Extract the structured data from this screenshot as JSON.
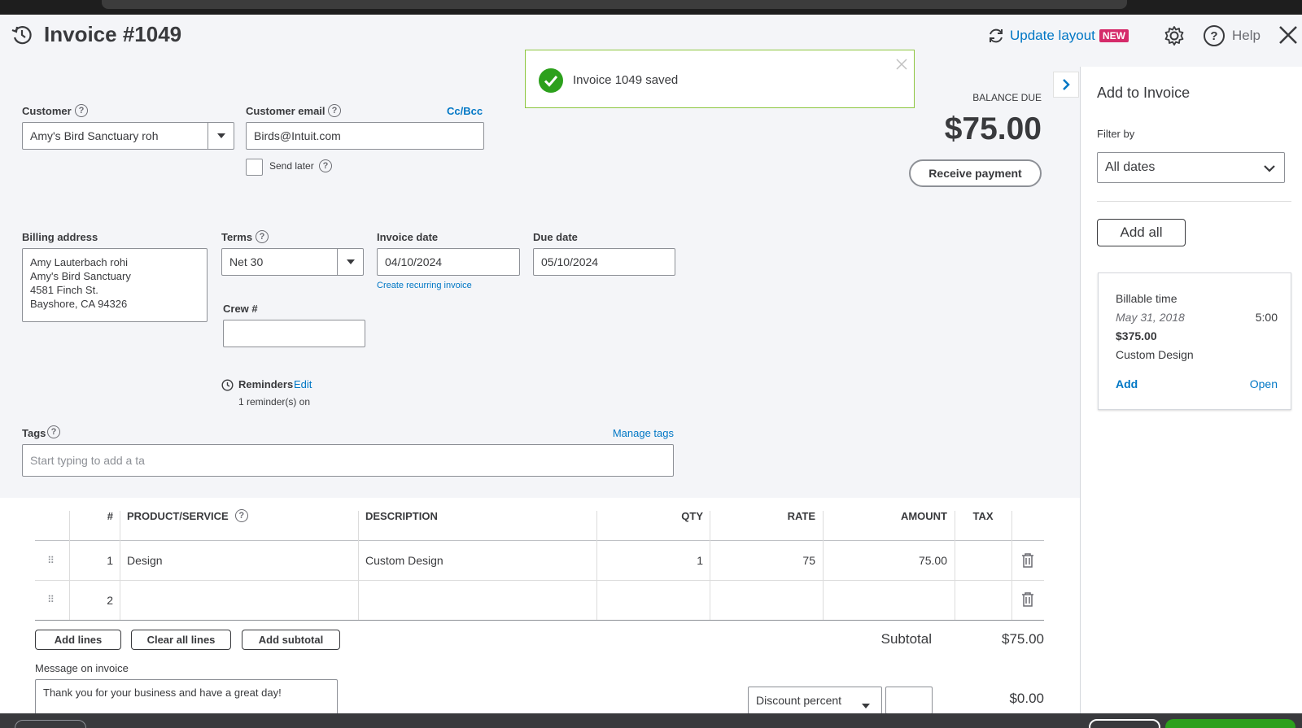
{
  "header": {
    "title": "Invoice #1049",
    "update_layout": "Update layout",
    "new_badge": "NEW",
    "help": "Help"
  },
  "toast": {
    "message": "Invoice 1049 saved"
  },
  "customer": {
    "label": "Customer",
    "value": "Amy's Bird Sanctuary roh"
  },
  "email": {
    "label": "Customer email",
    "cc_bcc": "Cc/Bcc",
    "value": "Birds@Intuit.com",
    "send_later": "Send later"
  },
  "balance": {
    "label": "BALANCE DUE",
    "amount": "$75.00",
    "receive_button": "Receive payment"
  },
  "billing": {
    "label": "Billing address",
    "lines": [
      "Amy Lauterbach rohi",
      "Amy's Bird Sanctuary",
      "4581 Finch St.",
      "Bayshore, CA  94326"
    ]
  },
  "terms": {
    "label": "Terms",
    "value": "Net 30"
  },
  "invoice_date": {
    "label": "Invoice date",
    "value": "04/10/2024",
    "recurring_link": "Create recurring invoice"
  },
  "due_date": {
    "label": "Due date",
    "value": "05/10/2024"
  },
  "crew": {
    "label": "Crew #",
    "value": ""
  },
  "reminders": {
    "label": "Reminders",
    "edit": "Edit",
    "status": "1 reminder(s) on"
  },
  "tags": {
    "label": "Tags",
    "manage": "Manage tags",
    "placeholder": "Start typing to add a ta"
  },
  "table": {
    "headers": {
      "num": "#",
      "product": "PRODUCT/SERVICE",
      "description": "DESCRIPTION",
      "qty": "QTY",
      "rate": "RATE",
      "amount": "AMOUNT",
      "tax": "TAX"
    },
    "rows": [
      {
        "num": "1",
        "product": "Design",
        "description": "Custom Design",
        "qty": "1",
        "rate": "75",
        "amount": "75.00"
      },
      {
        "num": "2",
        "product": "",
        "description": "",
        "qty": "",
        "rate": "",
        "amount": ""
      }
    ]
  },
  "actions": {
    "add_lines": "Add lines",
    "clear_lines": "Clear all lines",
    "add_subtotal": "Add subtotal"
  },
  "subtotal": {
    "label": "Subtotal",
    "value": "$75.00"
  },
  "message": {
    "label": "Message on invoice",
    "value": "Thank you for your business and have a great day!"
  },
  "discount": {
    "type": "Discount percent",
    "value": "$0.00"
  },
  "side_panel": {
    "title": "Add to Invoice",
    "filter_label": "Filter by",
    "filter_value": "All dates",
    "add_all": "Add all",
    "card": {
      "title": "Billable time",
      "date": "May 31, 2018",
      "hours": "5:00",
      "amount": "$375.00",
      "description": "Custom Design",
      "add": "Add",
      "open": "Open"
    }
  },
  "colors": {
    "accent_blue": "#0077c5",
    "success_green": "#2ca01c",
    "new_badge": "#d52b6a"
  }
}
